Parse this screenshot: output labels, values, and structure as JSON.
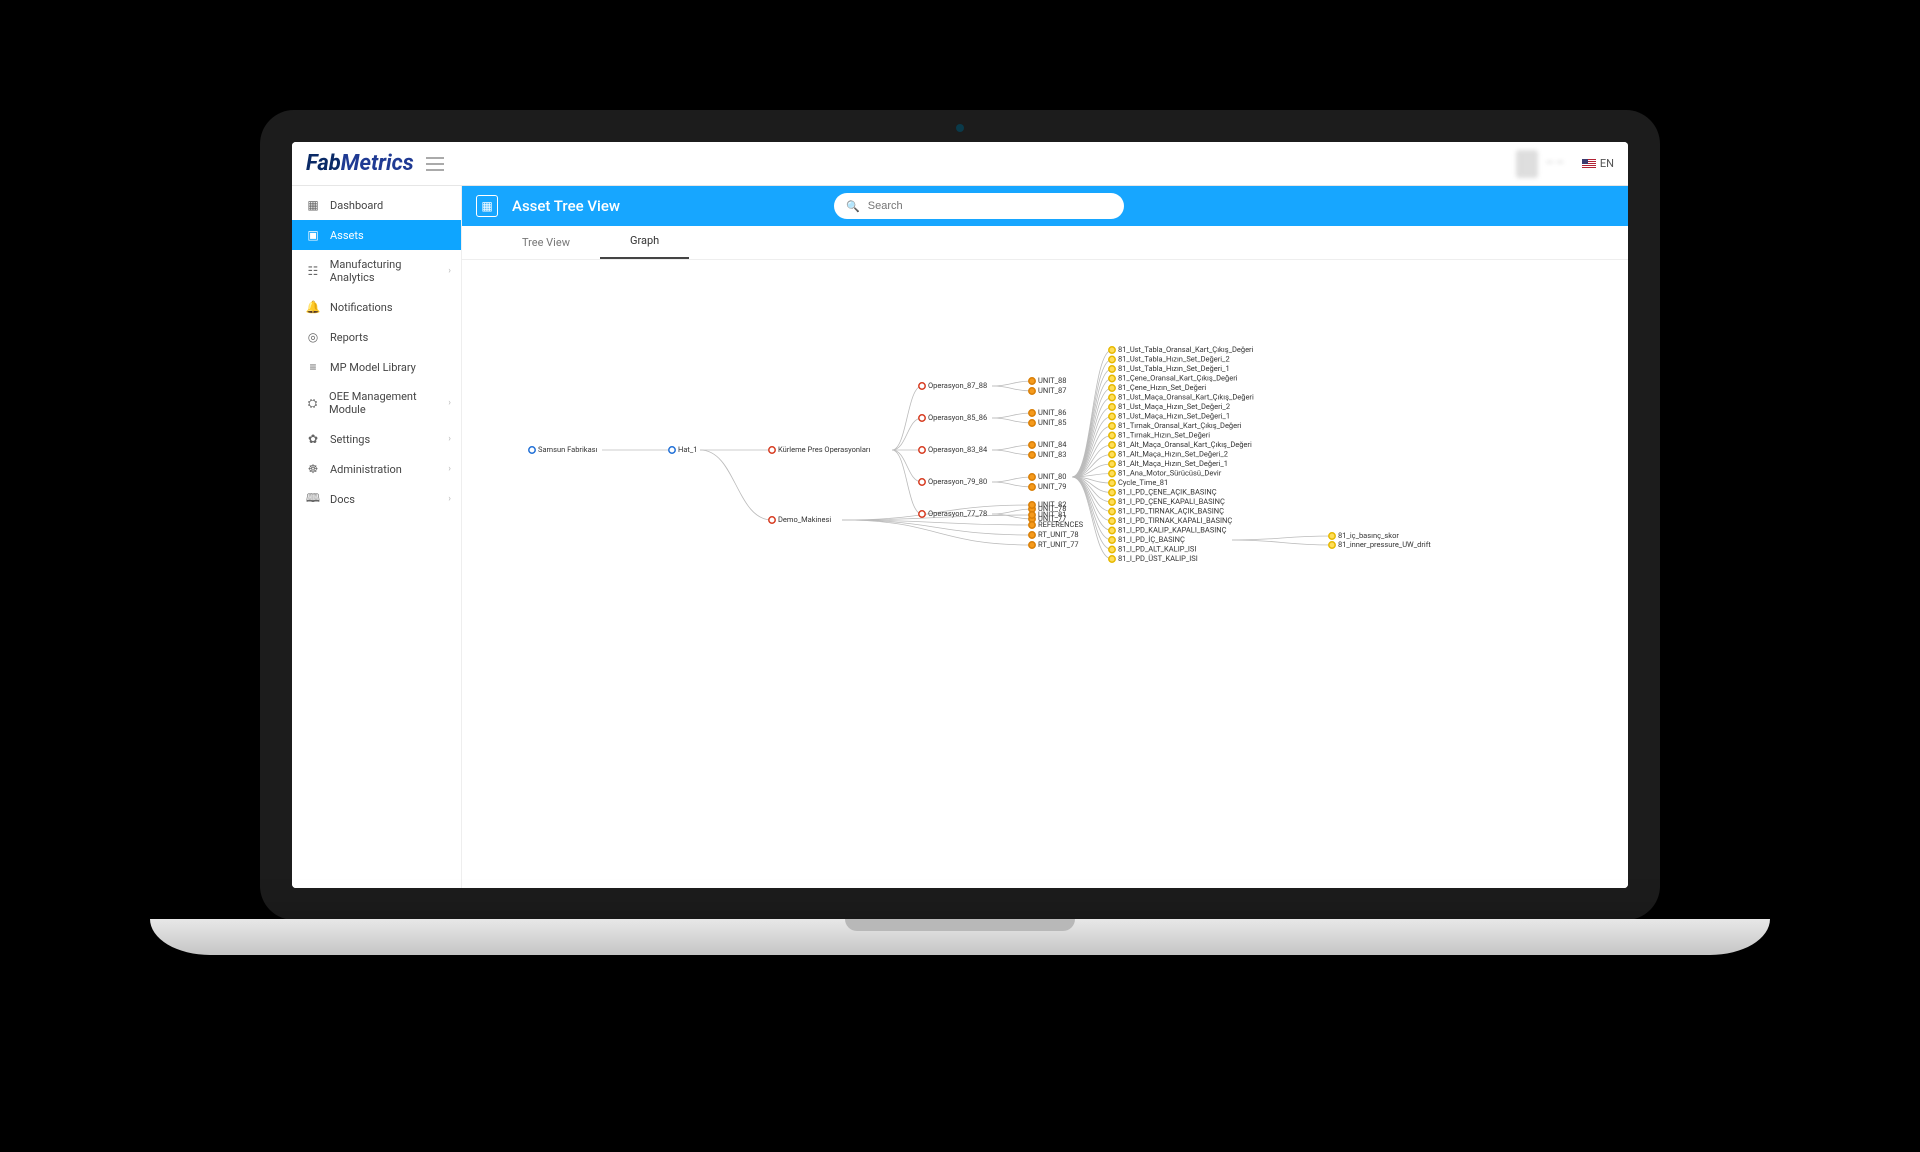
{
  "brand": {
    "fab": "Fab",
    "metrics": "Metrics"
  },
  "lang": "EN",
  "search": {
    "placeholder": "Search"
  },
  "page_title": "Asset Tree View",
  "sidebar": {
    "items": [
      {
        "label": "Dashboard",
        "icon": "▦",
        "chev": false
      },
      {
        "label": "Assets",
        "icon": "▣",
        "chev": false
      },
      {
        "label": "Manufacturing Analytics",
        "icon": "☷",
        "chev": true
      },
      {
        "label": "Notifications",
        "icon": "🔔",
        "chev": false
      },
      {
        "label": "Reports",
        "icon": "◎",
        "chev": false
      },
      {
        "label": "MP Model Library",
        "icon": "≡",
        "chev": false
      },
      {
        "label": "OEE Management Module",
        "icon": "⛭",
        "chev": true
      },
      {
        "label": "Settings",
        "icon": "✿",
        "chev": true
      },
      {
        "label": "Administration",
        "icon": "☸",
        "chev": true
      },
      {
        "label": "Docs",
        "icon": "🕮",
        "chev": true
      }
    ],
    "active_index": 1
  },
  "tabs": [
    {
      "label": "Tree View"
    },
    {
      "label": "Graph"
    }
  ],
  "active_tab": 1,
  "graph": {
    "root": {
      "label": "Samsun Fabrikası",
      "color": "blue"
    },
    "level1": {
      "label": "Hat_1",
      "color": "blue"
    },
    "level2": [
      {
        "label": "Kürleme Pres Operasyonları",
        "color": "red"
      },
      {
        "label": "Demo_Makinesi",
        "color": "red"
      }
    ],
    "ops": [
      {
        "label": "Operasyon_87_88",
        "units": [
          "UNIT_88",
          "UNIT_87"
        ]
      },
      {
        "label": "Operasyon_85_86",
        "units": [
          "UNIT_86",
          "UNIT_85"
        ]
      },
      {
        "label": "Operasyon_83_84",
        "units": [
          "UNIT_84",
          "UNIT_83"
        ]
      },
      {
        "label": "Operasyon_79_80",
        "units": [
          "UNIT_80",
          "UNIT_79"
        ]
      },
      {
        "label": "Operasyon_77_78",
        "units": [
          "UNIT_78",
          "UNIT_77"
        ]
      }
    ],
    "demo_units": [
      "UNIT_82",
      "UNIT_81",
      "REFERENCES",
      "RT_UNIT_78",
      "RT_UNIT_77"
    ],
    "tags_parent_index": 3,
    "tags": [
      "81_Ust_Tabla_Oransal_Kart_Çıkış_Değeri",
      "81_Ust_Tabla_Hızın_Set_Değeri_2",
      "81_Ust_Tabla_Hızın_Set_Değeri_1",
      "81_Çene_Oransal_Kart_Çıkış_Değeri",
      "81_Çene_Hızın_Set_Değeri",
      "81_Ust_Maça_Oransal_Kart_Çıkış_Değeri",
      "81_Ust_Maça_Hızın_Set_Değeri_2",
      "81_Ust_Maça_Hızın_Set_Değeri_1",
      "81_Tırnak_Oransal_Kart_Çıkış_Değeri",
      "81_Tırnak_Hızın_Set_Değeri",
      "81_Alt_Maça_Oransal_Kart_Çıkış_Değeri",
      "81_Alt_Maça_Hızın_Set_Değeri_2",
      "81_Alt_Maça_Hızın_Set_Değeri_1",
      "81_Ana_Motor_Sürücüsü_Devir",
      "Cycle_Time_81",
      "81_I_PD_ÇENE_AÇIK_BASINÇ",
      "81_I_PD_ÇENE_KAPALI_BASINÇ",
      "81_I_PD_TIRNAK_AÇIK_BASINÇ",
      "81_I_PD_TIRNAK_KAPALI_BASINÇ",
      "81_I_PD_KALIP_KAPALI_BASINÇ",
      "81_I_PD_İÇ_BASINÇ",
      "81_I_PD_ALT_KALIP_ISI",
      "81_I_PD_ÜST_KALIP_ISI"
    ],
    "tag_side_right": [
      {
        "label": "81_iç_basınç_skor",
        "from": 20
      },
      {
        "label": "81_inner_pressure_UW_drift",
        "from": 20
      }
    ]
  }
}
